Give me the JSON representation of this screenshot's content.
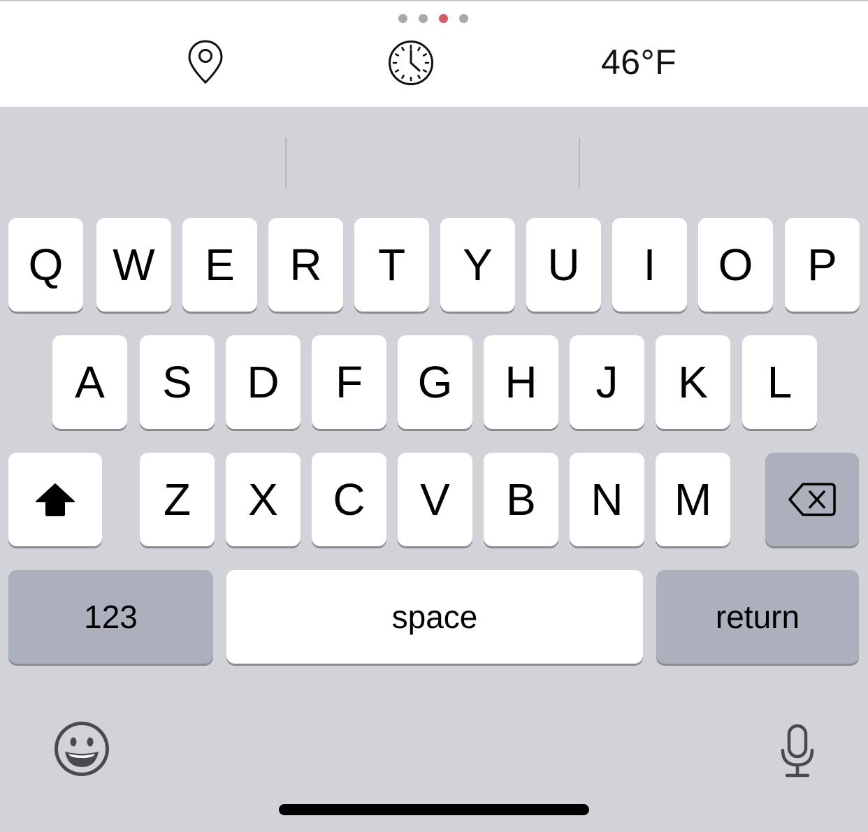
{
  "status_bar": {
    "page_indicator": {
      "count": 4,
      "active_index": 2
    },
    "location_icon": "map-pin-icon",
    "clock_icon": "clock-icon",
    "temperature": "46°F"
  },
  "keyboard": {
    "row1": [
      "Q",
      "W",
      "E",
      "R",
      "T",
      "Y",
      "U",
      "I",
      "O",
      "P"
    ],
    "row2": [
      "A",
      "S",
      "D",
      "F",
      "G",
      "H",
      "J",
      "K",
      "L"
    ],
    "row3": [
      "Z",
      "X",
      "C",
      "V",
      "B",
      "N",
      "M"
    ],
    "shift_icon": "shift-arrow-icon",
    "delete_icon": "backspace-icon",
    "numbers_label": "123",
    "space_label": "space",
    "return_label": "return",
    "emoji_icon": "emoji-smile-icon",
    "mic_icon": "microphone-icon"
  },
  "colors": {
    "keyboard_bg": "#d1d3d9",
    "key_light": "#ffffff",
    "key_dark": "#abb0bc",
    "active_dot": "#d35a6a",
    "inactive_dot": "#a9a9ad"
  }
}
